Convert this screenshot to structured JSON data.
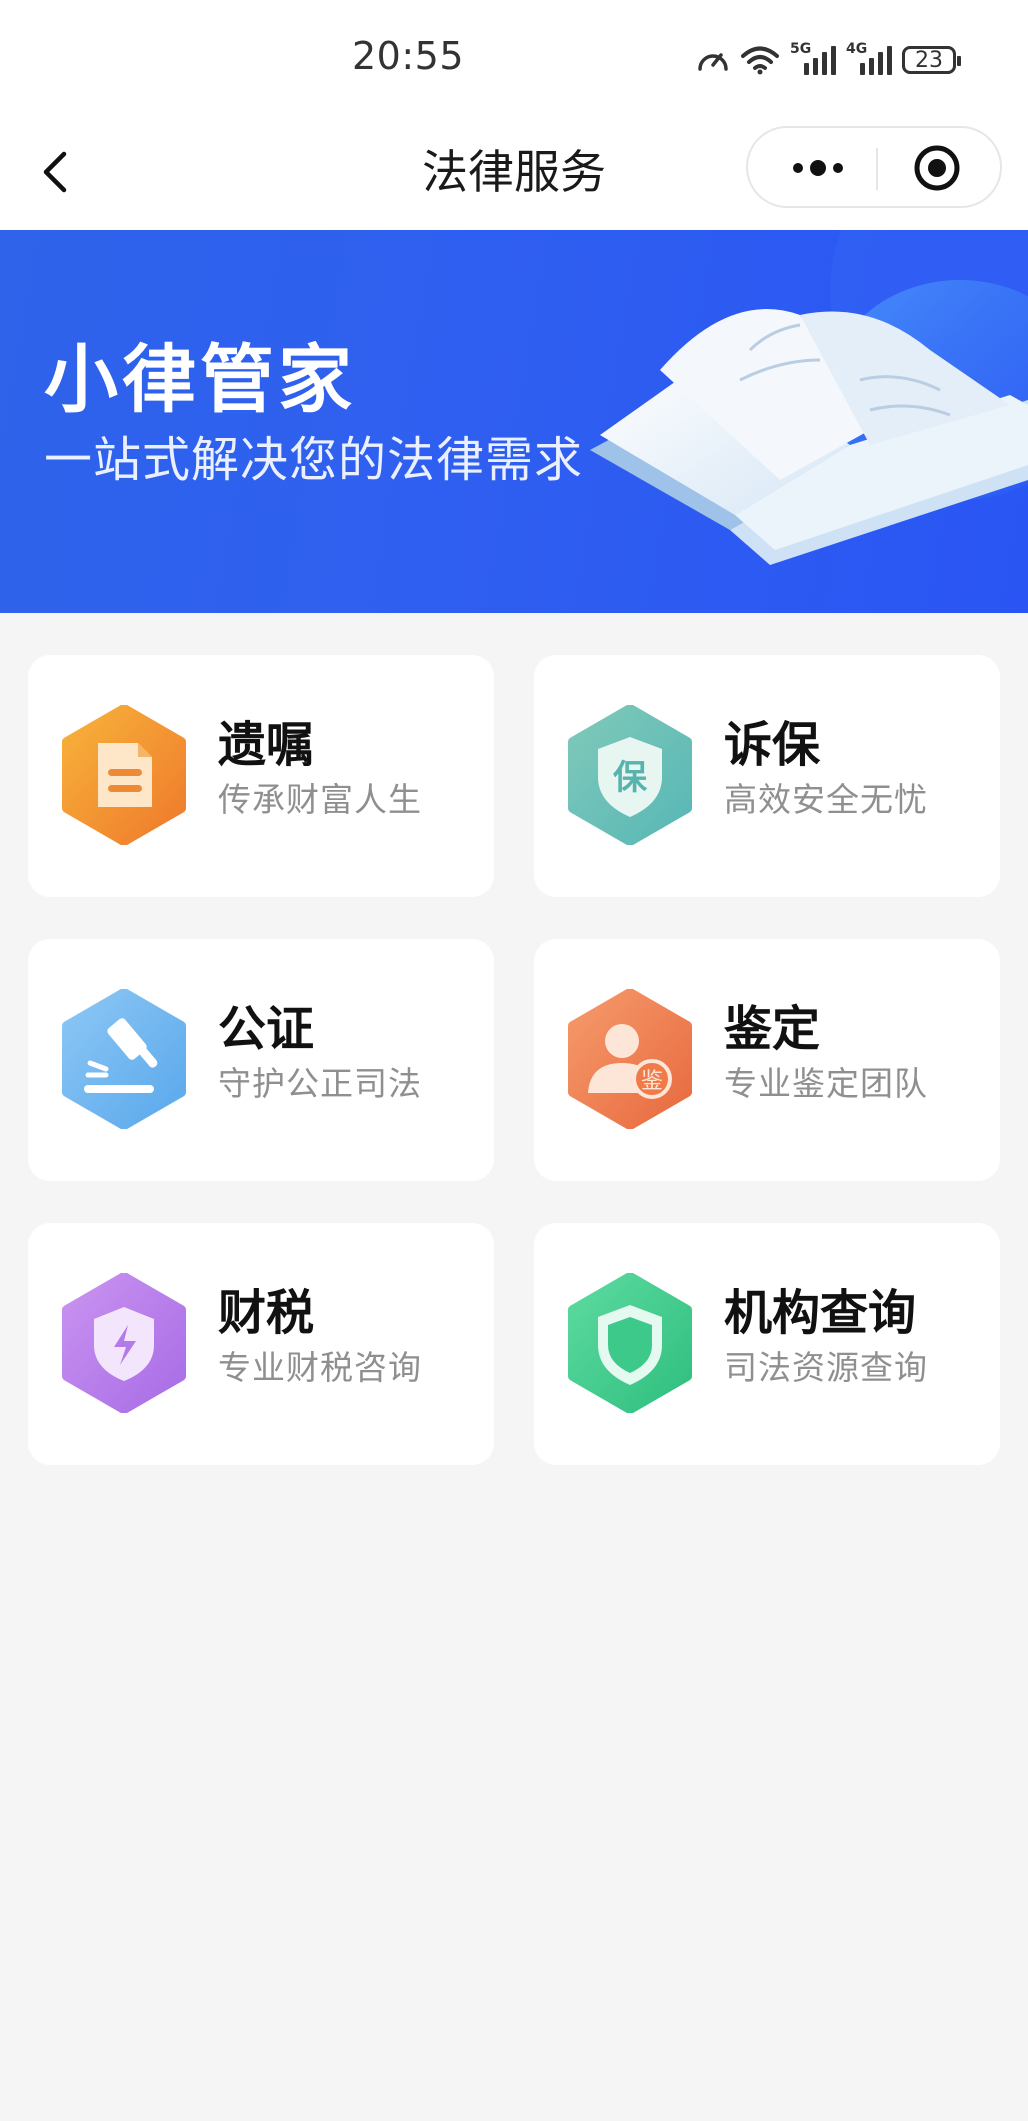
{
  "status_bar": {
    "time": "20:55",
    "net1": "5G",
    "net2": "4G",
    "battery": "23"
  },
  "nav": {
    "title": "法律服务",
    "back_icon": "chevron-left-icon",
    "more_icon": "more-dots-icon",
    "close_icon": "target-circle-icon"
  },
  "banner": {
    "title": "小律管家",
    "subtitle": "一站式解决您的法律需求",
    "art_icon": "open-book-illustration"
  },
  "services": [
    {
      "title": "遗嘱",
      "subtitle": "传承财富人生",
      "icon": "document-icon",
      "color_from": "#f7b23a",
      "color_to": "#ef7a2c",
      "glyph": ""
    },
    {
      "title": "诉保",
      "subtitle": "高效安全无忧",
      "icon": "shield-bao-icon",
      "color_from": "#7fc9b9",
      "color_to": "#58b7b6",
      "glyph": "保"
    },
    {
      "title": "公证",
      "subtitle": "守护公正司法",
      "icon": "gavel-icon",
      "color_from": "#8cc7f4",
      "color_to": "#5aa8ec",
      "glyph": ""
    },
    {
      "title": "鉴定",
      "subtitle": "专业鉴定团队",
      "icon": "appraiser-icon",
      "color_from": "#f59a6b",
      "color_to": "#e86a3f",
      "glyph": "鉴"
    },
    {
      "title": "财税",
      "subtitle": "专业财税咨询",
      "icon": "shield-lightning-icon",
      "color_from": "#c993f0",
      "color_to": "#a86ce6",
      "glyph": ""
    },
    {
      "title": "机构查询",
      "subtitle": "司法资源查询",
      "icon": "shield-check-icon",
      "color_from": "#5ddaa0",
      "color_to": "#2fbf7f",
      "glyph": ""
    }
  ]
}
